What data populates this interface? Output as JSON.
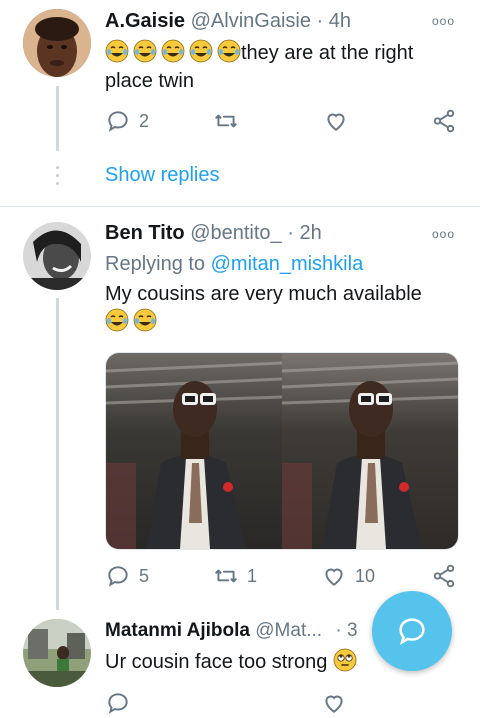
{
  "tweets": [
    {
      "name": "A.Gaisie",
      "handle": "@AlvinGaisie",
      "time": "4h",
      "separator": "·",
      "text": "they are at the right place twin",
      "replies": "2",
      "retweets": "",
      "likes": ""
    },
    {
      "name": "Ben Tito",
      "handle": "@bentito_",
      "time": "2h",
      "separator": "·",
      "replying_label": "Replying to",
      "replying_to": "@mitan_mishkila",
      "text": "My cousins are very much available",
      "replies": "5",
      "retweets": "1",
      "likes": "10"
    },
    {
      "name": "Matanmi Ajibola",
      "handle": "@Mat...",
      "time": "3",
      "separator": "·",
      "text": "Ur cousin face too strong"
    }
  ],
  "show_replies": "Show replies",
  "more_glyph": "ooo",
  "icons": {
    "reply": "reply-icon",
    "retweet": "retweet-icon",
    "like": "heart-icon",
    "share": "share-icon",
    "compose": "compose-reply-icon",
    "emoji_laugh": "face-with-tears-of-joy-icon",
    "emoji_roll": "face-with-rolling-eyes-icon"
  },
  "colors": {
    "link": "#1da1f2",
    "muted": "#657786",
    "fab": "#55c3ec",
    "thread_line": "#cfd9de"
  }
}
